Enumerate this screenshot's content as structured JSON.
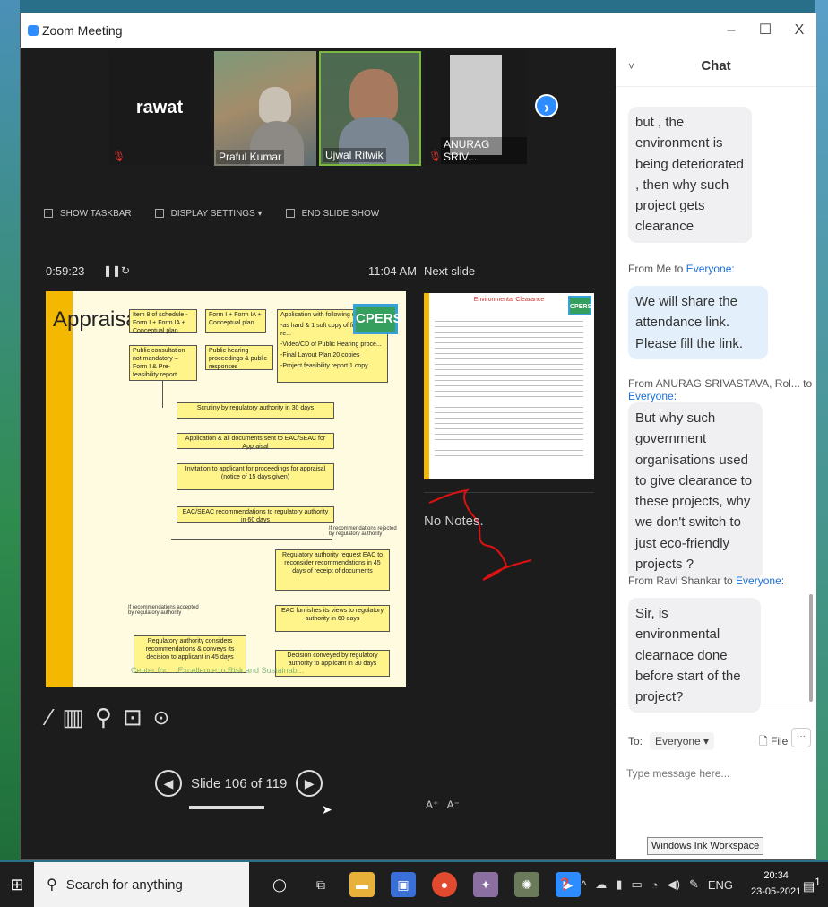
{
  "window": {
    "title": "Zoom Meeting",
    "minimize": "–",
    "maximize": "☐",
    "close": "X"
  },
  "participants": [
    {
      "name": "",
      "display_text": "rawat"
    },
    {
      "name": "Praful Kumar"
    },
    {
      "name": "Ujwal Ritwik"
    },
    {
      "name": "ANURAG SRIV..."
    }
  ],
  "toolbar": {
    "show_taskbar": "SHOW TASKBAR",
    "display_settings": "DISPLAY SETTINGS ▾",
    "end_slide_show": "END SLIDE SHOW"
  },
  "presenter": {
    "timer": "0:59:23",
    "clock": "11:04 AM",
    "next_slide_label": "Next slide",
    "notes": "No Notes.",
    "slide_counter": "Slide 106 of 119"
  },
  "slide": {
    "title": "Appraisal",
    "logo": "CPERS",
    "boxes": {
      "b1": "Item 8 of schedule - Form I + Form IA + Conceptual plan",
      "b2": "Form I + Form IA + Conceptual plan",
      "b3": "Application with following docu...",
      "b3a": "-as hard & 1 soft copy of final EIA re...",
      "b3b": "-Video/CD of Public Hearing proce...",
      "b3c": "-Final Layout Plan 20 copies",
      "b3d": "-Project feasibility report 1 copy",
      "b4": "Public consultation not mandatory – Form I & Pre-feasibility report",
      "b5": "Public hearing proceedings & public responses",
      "s1": "Scrutiny by regulatory authority in 30 days",
      "s2": "Application & all documents sent to EAC/SEAC for Appraisal",
      "s3": "Invitation to applicant for proceedings for appraisal (notice of 15 days given)",
      "s4": "EAC/SEAC recommendations to regulatory authority in 60 days",
      "r1": "Regulatory authority request EAC to reconsider recommendations in 45 days of receipt of documents",
      "r2": "EAC furnishes its views to regulatory authority in 60 days",
      "r3": "Decision conveyed by regulatory authority to applicant in 30 days",
      "l1": "Regulatory authority considers recommendations & conveys its decision to applicant in 45 days",
      "note_rejected": "If recommendations rejected by regulatory authority",
      "note_accepted": "If recommendations accepted by regulatory authority"
    },
    "watermark": "Center for ... Excellence in Risk and Sustainab..."
  },
  "next_slide": {
    "header": "Environmental Clearance",
    "logo": "CPERS"
  },
  "chat": {
    "title": "Chat",
    "messages": [
      {
        "from": "",
        "to": "",
        "text": "but , the environment is being deteriorated , then why such project gets clearance"
      },
      {
        "from": "From Me to ",
        "to": "Everyone:",
        "text": "We will share the attendance link. Please fill the link."
      },
      {
        "from": "From ANURAG SRIVASTAVA, Rol... to ",
        "to": "Everyone:",
        "text": "But why such government organisations  used to give clearance to these projects, why we don't switch to just eco-friendly projects ?"
      },
      {
        "from": "From Ravi Shankar to ",
        "to": "Everyone:",
        "text": "Sir, is environmental clearnace done before start of the project?"
      }
    ],
    "to_label": "To:",
    "to_value": "Everyone ▾",
    "file_label": "File",
    "more_label": "···",
    "input_placeholder": "Type message here..."
  },
  "tooltip": "Windows Ink Workspace",
  "taskbar": {
    "search_placeholder": "Search for anything",
    "lang": "ENG",
    "time": "20:34",
    "date": "23-05-2021",
    "notif_count": "1"
  },
  "colors": {
    "zoom_blue": "#2d8cff",
    "slide_yellow": "#fff48a",
    "slide_stripe": "#f5b800",
    "cpers_green": "#35a05e"
  }
}
